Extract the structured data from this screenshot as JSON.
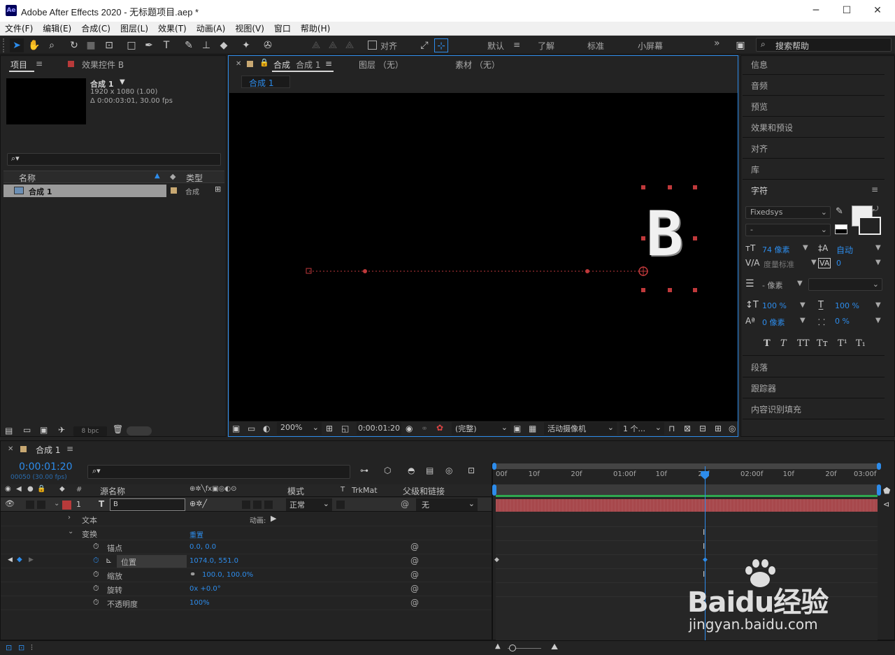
{
  "window": {
    "title": "Adobe After Effects 2020 - 无标题项目.aep *",
    "logo": "Ae",
    "minimize": "─",
    "maximize": "☐",
    "close": "✕"
  },
  "menu": [
    "文件(F)",
    "编辑(E)",
    "合成(C)",
    "图层(L)",
    "效果(T)",
    "动画(A)",
    "视图(V)",
    "窗口",
    "帮助(H)"
  ],
  "toolbar": {
    "align_label": "对齐",
    "workspaces": [
      "默认",
      "了解",
      "标准",
      "小屏幕"
    ],
    "active_workspace": "默认",
    "more": "»",
    "search_placeholder": "搜索帮助"
  },
  "project": {
    "tab_label": "项目",
    "effects_tab": "效果控件 B",
    "comp_name": "合成 1",
    "comp_size": "1920 x 1080 (1.00)",
    "comp_duration": "Δ 0:00:03:01, 30.00 fps",
    "col_name": "名称",
    "col_type": "类型",
    "item_name": "合成 1",
    "item_type": "合成",
    "bpc": "8 bpc"
  },
  "viewer": {
    "tab_comp_prefix": "合成",
    "tab_comp_name": "合成 1",
    "tab_layer": "图层 （无）",
    "tab_footage": "素材 （无）",
    "breadcrumb": "合成 1",
    "letter": "B",
    "zoom": "200%",
    "timecode": "0:00:01:20",
    "resolution": "(完整)",
    "camera": "活动摄像机",
    "views": "1 个..."
  },
  "right_panel": {
    "items_top": [
      "信息",
      "音频",
      "预览",
      "效果和预设",
      "对齐",
      "库"
    ],
    "character_title": "字符",
    "font": "Fixedsys",
    "font_style": "-",
    "font_size": "74 像素",
    "leading": "自动",
    "kerning": "度量标准",
    "tracking": "0",
    "stroke_width": "- 像素",
    "vert_scale": "100 %",
    "horiz_scale": "100 %",
    "baseline": "0 像素",
    "tsume": "0 %",
    "text_style_buttons": [
      "T",
      "T",
      "TT",
      "Tт",
      "T¹",
      "T₁"
    ],
    "items_bottom": [
      "段落",
      "跟踪器",
      "内容识别填充"
    ]
  },
  "timeline": {
    "tab": "合成 1",
    "timecode": "0:00:01:20",
    "frame_info": "00050 (30.00 fps)",
    "col_source_name": "源名称",
    "col_mode": "模式",
    "col_t": "T",
    "col_trkmat": "TrkMat",
    "col_parent": "父级和链接",
    "layer_index": "1",
    "layer_name": "B",
    "layer_mode": "正常",
    "layer_parent": "无",
    "text_label": "文本",
    "animate_label": "动画:",
    "transform_label": "变换",
    "reset_label": "重置",
    "properties": [
      {
        "name": "锚点",
        "value": "0.0, 0.0"
      },
      {
        "name": "位置",
        "value": "1074.0, 551.0"
      },
      {
        "name": "缩放",
        "value": "100.0, 100.0%"
      },
      {
        "name": "旋转",
        "value": "0x +0.0°"
      },
      {
        "name": "不透明度",
        "value": "100%"
      }
    ],
    "ruler_ticks": [
      "00f",
      "10f",
      "20f",
      "01:00f",
      "10f",
      "20f",
      "02:00f",
      "10f",
      "20f",
      "03:00f"
    ],
    "current_time_fraction": 0.548
  },
  "watermark": {
    "brand": "Baidu经验",
    "url": "jingyan.baidu.com"
  },
  "colors": {
    "accent_blue": "#2d8ceb",
    "layer_red": "#b83a3a",
    "motion_path_red": "#c0393b",
    "comp_tan": "#c8a872"
  }
}
